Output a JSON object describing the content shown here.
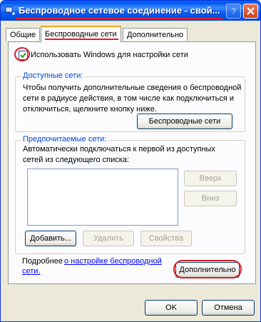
{
  "window": {
    "title": "Беспроводное сетевое соединение - свой...",
    "help_label": "?",
    "close_label": "X"
  },
  "tabs": [
    {
      "label": "Общие"
    },
    {
      "label": "Беспроводные сети",
      "active": true
    },
    {
      "label": "Дополнительно"
    }
  ],
  "use_windows": {
    "label": "Использовать Windows для настройки сети",
    "checked": true
  },
  "available": {
    "title": "Доступные сети:",
    "description": [
      "Чтобы получить дополнительные сведения о беспроводной",
      "сети в радиусе действия, в том числе как подключиться и",
      "отключиться, щелкните кнопку ниже."
    ],
    "button": "Беспроводные сети"
  },
  "preferred": {
    "title": "Предпочитаемые сети:",
    "description": [
      "Автоматически подключаться к первой из доступных",
      "сетей из следующего списка:"
    ],
    "items": [],
    "up": "Вверх",
    "down": "Вниз",
    "add": "Добавить...",
    "remove": "Удалить",
    "properties": "Свойства"
  },
  "more_info": {
    "prefix": "Подробнее",
    "link_1": "о настройке  беспроводной",
    "link_2": "сети."
  },
  "advanced_button": "Дополнительно",
  "ok": "OK",
  "cancel": "Отмена",
  "colors": {
    "titlebar": "#0a5df0",
    "group_title": "#0046d5",
    "highlight": "#d81b2a"
  }
}
